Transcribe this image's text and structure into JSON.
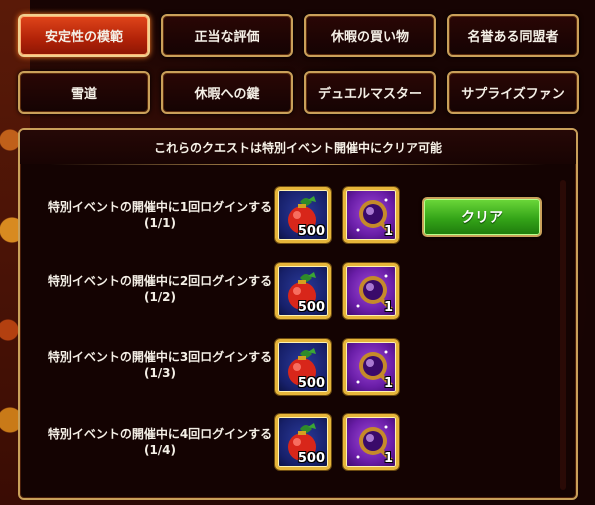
{
  "tabs": [
    {
      "label": "安定性の模範",
      "active": true
    },
    {
      "label": "正当な評価",
      "active": false
    },
    {
      "label": "休暇の買い物",
      "active": false
    },
    {
      "label": "名誉ある同盟者",
      "active": false
    },
    {
      "label": "雪道",
      "active": false
    },
    {
      "label": "休暇への鍵",
      "active": false
    },
    {
      "label": "デュエルマスター",
      "active": false
    },
    {
      "label": "サプライズファン",
      "active": false
    }
  ],
  "panel": {
    "header": "これらのクエストは特別イベント開催中にクリア可能"
  },
  "quests": [
    {
      "title": "特別イベントの開催中に1回ログインする",
      "progress": "(1/1)",
      "rewards": [
        {
          "icon": "ornament-icon",
          "count": "500"
        },
        {
          "icon": "magic-amulet-icon",
          "count": "1"
        }
      ],
      "claim_label": "クリア"
    },
    {
      "title": "特別イベントの開催中に2回ログインする",
      "progress": "(1/2)",
      "rewards": [
        {
          "icon": "ornament-icon",
          "count": "500"
        },
        {
          "icon": "magic-amulet-icon",
          "count": "1"
        }
      ]
    },
    {
      "title": "特別イベントの開催中に3回ログインする",
      "progress": "(1/3)",
      "rewards": [
        {
          "icon": "ornament-icon",
          "count": "500"
        },
        {
          "icon": "magic-amulet-icon",
          "count": "1"
        }
      ]
    },
    {
      "title": "特別イベントの開催中に4回ログインする",
      "progress": "(1/4)",
      "rewards": [
        {
          "icon": "ornament-icon",
          "count": "500"
        },
        {
          "icon": "magic-amulet-icon",
          "count": "1"
        }
      ]
    }
  ]
}
